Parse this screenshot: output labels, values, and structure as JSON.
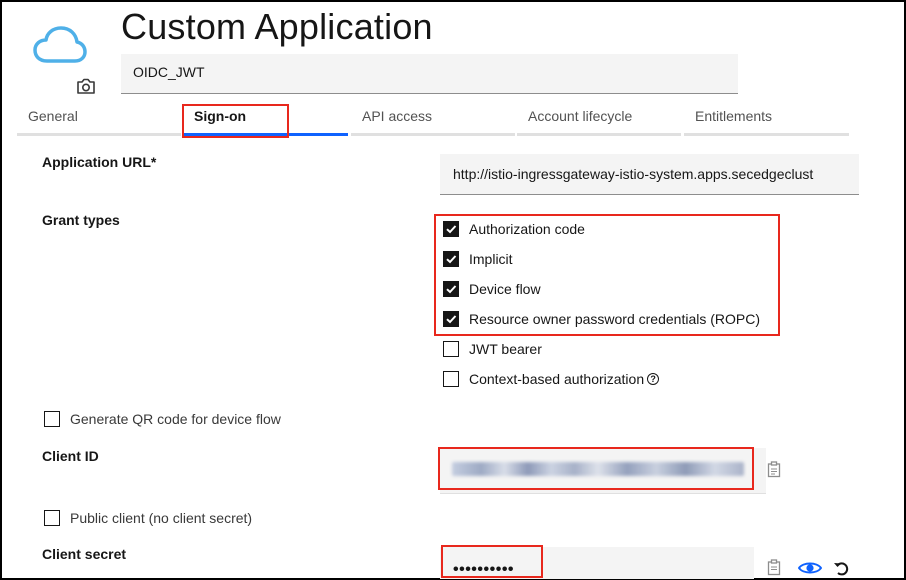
{
  "app": {
    "title": "Custom Application",
    "name_value": "OIDC_JWT",
    "icon": "cloud-icon",
    "photo_icon": "camera-icon"
  },
  "tabs": [
    {
      "label": "General",
      "active": false
    },
    {
      "label": "Sign-on",
      "active": true
    },
    {
      "label": "API access",
      "active": false
    },
    {
      "label": "Account lifecycle",
      "active": false
    },
    {
      "label": "Entitlements",
      "active": false
    }
  ],
  "form": {
    "app_url_label": "Application URL*",
    "app_url_value": "http://istio-ingressgateway-istio-system.apps.secedgeclust",
    "grant_types_label": "Grant types",
    "grant_types": [
      {
        "label": "Authorization code",
        "checked": true
      },
      {
        "label": "Implicit",
        "checked": true
      },
      {
        "label": "Device flow",
        "checked": true
      },
      {
        "label": "Resource owner password credentials (ROPC)",
        "checked": true
      },
      {
        "label": "JWT bearer",
        "checked": false
      },
      {
        "label": "Context-based authorization",
        "checked": false
      }
    ],
    "qr_label": "Generate QR code for device flow",
    "qr_checked": false,
    "client_id_label": "Client ID",
    "public_client_label": "Public client (no client secret)",
    "public_client_checked": false,
    "client_secret_label": "Client secret",
    "client_secret_value": "••••••••••"
  },
  "colors": {
    "accent": "#0f62fe",
    "highlight": "#e8281d",
    "eye": "#0f62fe",
    "field_bg": "#f4f4f4"
  }
}
